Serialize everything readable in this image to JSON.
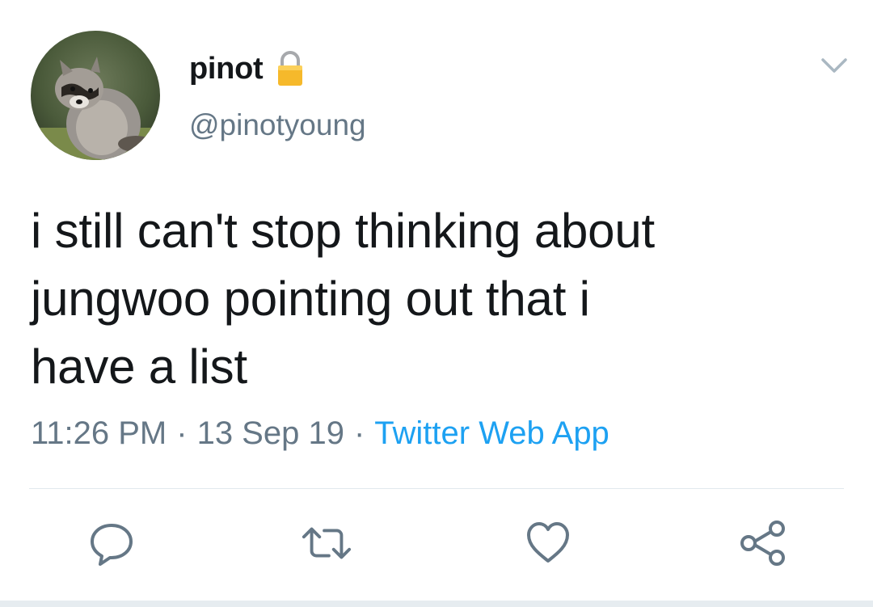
{
  "user": {
    "display_name": "pinot",
    "handle": "@pinotyoung",
    "avatar_icon": "raccoon-avatar",
    "protected_icon": "lock-icon"
  },
  "tweet": {
    "lines": [
      "i still can't stop thinking about",
      "jungwoo pointing out that i",
      "have a list"
    ],
    "time": "11:26 PM",
    "date": "13 Sep 19",
    "separator": "·",
    "source": "Twitter Web App"
  },
  "actions": {
    "reply_icon": "reply-icon",
    "retweet_icon": "retweet-icon",
    "like_icon": "heart-icon",
    "share_icon": "share-icon"
  },
  "colors": {
    "text": "#14171a",
    "secondary": "#657786",
    "accent": "#1da1f2",
    "divider": "#e1e8ed"
  }
}
